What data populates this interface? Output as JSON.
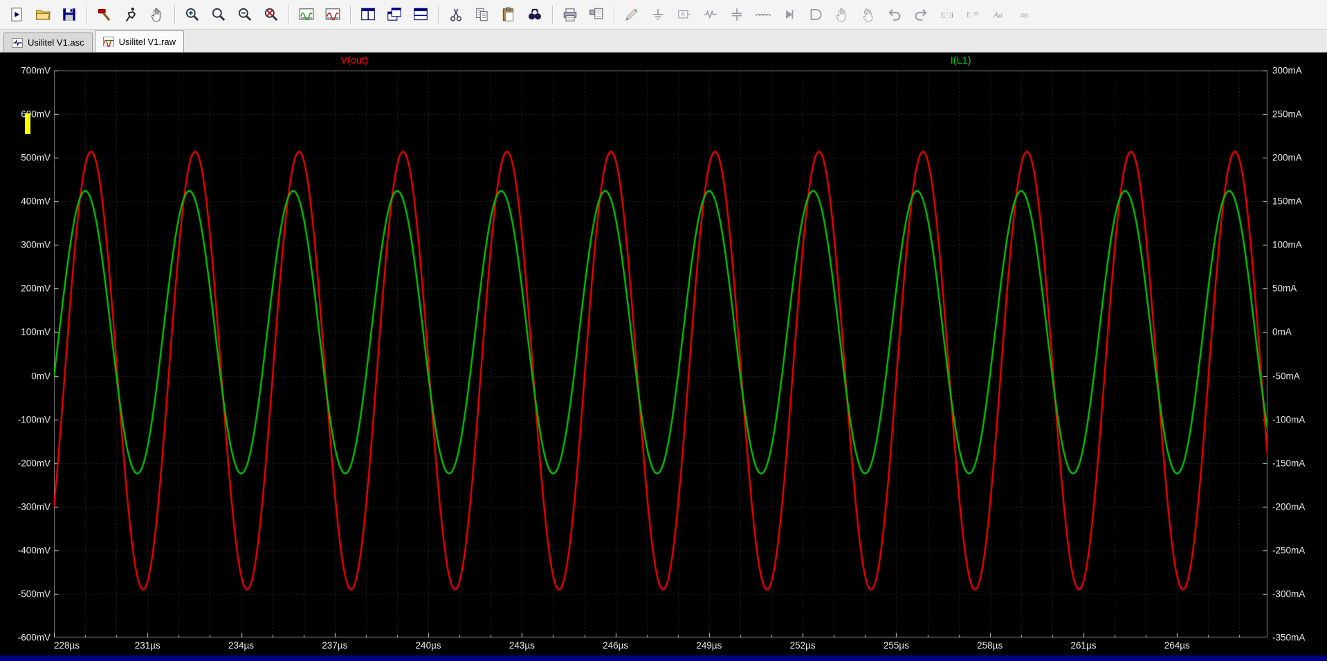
{
  "toolbar": {
    "buttons": [
      {
        "name": "new-schematic"
      },
      {
        "name": "open-file"
      },
      {
        "name": "save-file"
      },
      {
        "sep": true
      },
      {
        "name": "control-panel"
      },
      {
        "name": "run-simulation"
      },
      {
        "name": "halt-simulation"
      },
      {
        "sep": true
      },
      {
        "name": "zoom-in"
      },
      {
        "name": "zoom-back"
      },
      {
        "name": "zoom-out"
      },
      {
        "name": "zoom-full-extents"
      },
      {
        "sep": true
      },
      {
        "name": "autorange-y-axis"
      },
      {
        "name": "plot-settings"
      },
      {
        "sep": true
      },
      {
        "name": "tile-vertically"
      },
      {
        "name": "cascade-windows"
      },
      {
        "name": "tile-horizontally"
      },
      {
        "sep": true
      },
      {
        "name": "cut"
      },
      {
        "name": "copy"
      },
      {
        "name": "paste"
      },
      {
        "name": "find"
      },
      {
        "sep": true
      },
      {
        "name": "print"
      },
      {
        "name": "print-preview"
      },
      {
        "sep": true
      },
      {
        "name": "draw-wire",
        "disabled": true
      },
      {
        "name": "place-ground",
        "disabled": true
      },
      {
        "name": "place-net-label",
        "disabled": true
      },
      {
        "name": "place-resistor",
        "disabled": true
      },
      {
        "name": "place-capacitor",
        "disabled": true
      },
      {
        "name": "place-inductor",
        "disabled": true
      },
      {
        "name": "place-diode",
        "disabled": true
      },
      {
        "name": "place-component",
        "disabled": true
      },
      {
        "name": "move",
        "disabled": true
      },
      {
        "name": "drag",
        "disabled": true
      },
      {
        "name": "undo",
        "disabled": true
      },
      {
        "name": "redo",
        "disabled": true
      },
      {
        "name": "mirror",
        "glyph": "E",
        "disabled": true
      },
      {
        "name": "rotate",
        "glyph": "E",
        "disabled": true
      },
      {
        "name": "place-text",
        "glyph": "Aa",
        "disabled": true
      },
      {
        "name": "spice-directive",
        "glyph": ".op",
        "disabled": true
      }
    ]
  },
  "tabs": [
    {
      "label": "Usilitel V1.asc",
      "icon": "schematic",
      "active": false
    },
    {
      "label": "Usilitel V1.raw",
      "icon": "waveform",
      "active": true
    }
  ],
  "chart_data": {
    "type": "line",
    "background": "#000000",
    "grid": {
      "color": "#4b4b4b",
      "style": "dotted",
      "x_minor_step_us": 1,
      "y_divisions": 13,
      "tick_color": "#dcdcdc"
    },
    "x_axis": {
      "unit": "µs",
      "min": 228,
      "max": 266.9,
      "tick_step_us": 3,
      "tick_labels": [
        "228µs",
        "231µs",
        "234µs",
        "237µs",
        "240µs",
        "243µs",
        "246µs",
        "249µs",
        "252µs",
        "255µs",
        "258µs",
        "261µs",
        "264µs"
      ]
    },
    "y_axis_left": {
      "unit": "mV",
      "min": -600,
      "max": 700,
      "step": 100,
      "tick_labels": [
        "700mV",
        "600mV",
        "500mV",
        "400mV",
        "300mV",
        "200mV",
        "100mV",
        "0mV",
        "-100mV",
        "-200mV",
        "-300mV",
        "-400mV",
        "-500mV",
        "-600mV"
      ]
    },
    "y_axis_right": {
      "unit": "mA",
      "min": -350,
      "max": 300,
      "step": 50,
      "tick_labels": [
        "300mA",
        "250mA",
        "200mA",
        "150mA",
        "100mA",
        "50mA",
        "0mA",
        "-50mA",
        "-100mA",
        "-150mA",
        "-200mA",
        "-250mA",
        "-300mA",
        "-350mA"
      ]
    },
    "series": [
      {
        "name": "V(out)",
        "color": "#ff0000",
        "axis": "left",
        "waveform": "sine",
        "amplitude": 502,
        "offset": 12,
        "unit": "mV",
        "period_us": 3.3333,
        "phase_rad": -0.671,
        "label_x_frac": 0.267
      },
      {
        "name": "I(L1)",
        "color": "#00d000",
        "axis": "right",
        "waveform": "sine",
        "amplitude": 162,
        "offset": 0,
        "unit": "mA",
        "period_us": 3.3333,
        "phase_rad": -0.318,
        "label_x_frac": 0.724
      }
    ],
    "legend_position": "top-inside"
  }
}
